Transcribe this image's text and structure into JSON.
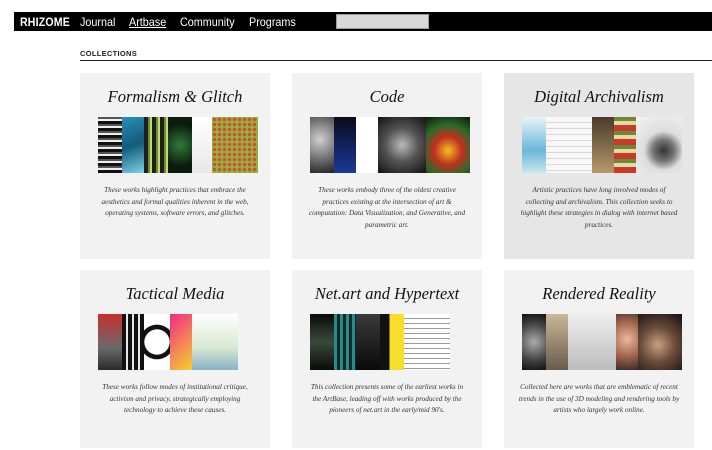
{
  "nav": {
    "brand": "RHIZOME",
    "items": [
      {
        "label": "Journal"
      },
      {
        "label": "Artbase"
      },
      {
        "label": "Community"
      },
      {
        "label": "Programs"
      }
    ],
    "search_placeholder": ""
  },
  "section": {
    "title": "COLLECTIONS"
  },
  "collections": [
    {
      "title": "Formalism & Glitch",
      "description": "These works highlight practices that embrace the aesthetics and formal qualities inherent in the web, operating systems, software errors, and glitches."
    },
    {
      "title": "Code",
      "description": "These works embody three of the oldest creative practices existing at the intersection of art & computation: Data Visualization, and Generative, and parametric art."
    },
    {
      "title": "Digital Archivalism",
      "description": "Artistic practices have long involved modes of collecting and archivalism. This collection seeks to highlight these strategies in dialog with internet based practices."
    },
    {
      "title": "Tactical Media",
      "description": "These works follow modes of institutional critique, activism and privacy, strategically employing technology to achieve these causes."
    },
    {
      "title": "Net.art and Hypertext",
      "description": "This collection presents some of the earliest works in the ArtBase, leading off with works produced by the pioneers of net.art in the early/mid 90's."
    },
    {
      "title": "Rendered Reality",
      "description": "Collected here are works that are emblematic of recent trends in the use of 3D modeling and rendering tools by artists who largely work online."
    }
  ],
  "colors": {
    "nav_bg": "#000000",
    "card_bg": "#f2f2f2",
    "card_hover_bg": "#e6e6e6"
  }
}
